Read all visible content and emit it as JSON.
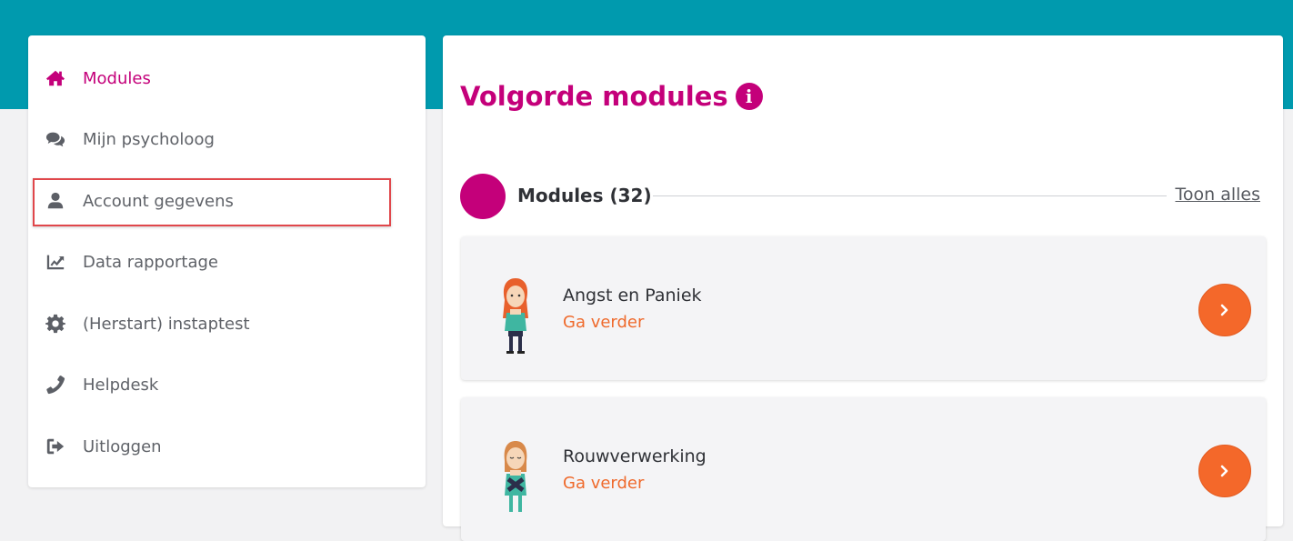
{
  "colors": {
    "brand": "#c4007a",
    "header": "#009aae",
    "accent": "#f4682a"
  },
  "sidebar": {
    "items": [
      {
        "label": "Modules",
        "icon": "home-icon",
        "active": true
      },
      {
        "label": "Mijn psycholoog",
        "icon": "chat-icon"
      },
      {
        "label": "Account gegevens",
        "icon": "user-icon"
      },
      {
        "label": "Data rapportage",
        "icon": "chart-icon"
      },
      {
        "label": "(Herstart) instaptest",
        "icon": "gear-icon"
      },
      {
        "label": "Helpdesk",
        "icon": "phone-icon"
      },
      {
        "label": "Uitloggen",
        "icon": "sign-out-icon"
      }
    ]
  },
  "main": {
    "title": "Volgorde modules",
    "section": {
      "title": "Modules (32)",
      "show_all": "Toon alles"
    },
    "modules": [
      {
        "title": "Angst en Paniek",
        "status": "Ga verder"
      },
      {
        "title": "Rouwverwerking",
        "status": "Ga verder"
      }
    ]
  }
}
